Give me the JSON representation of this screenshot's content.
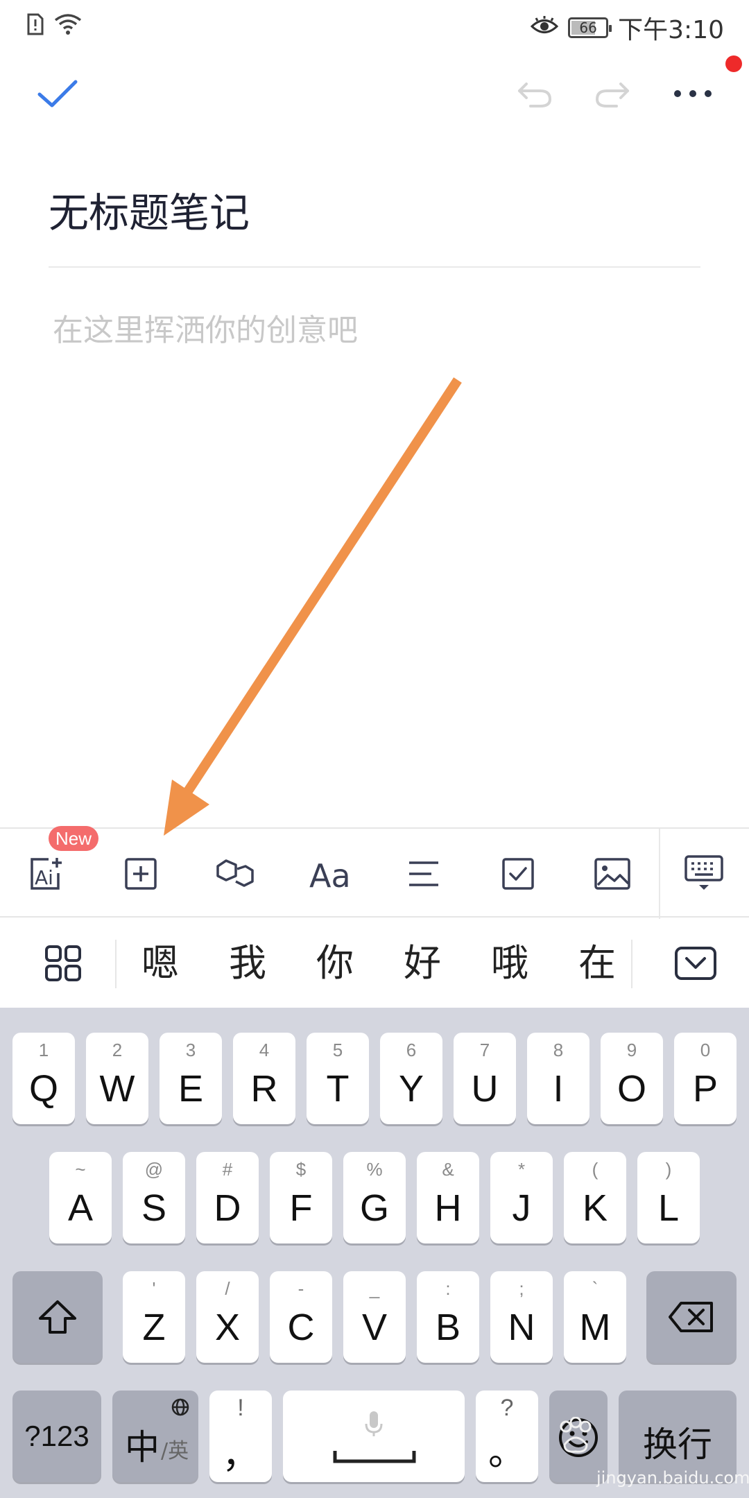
{
  "status_bar": {
    "time": "下午3:10",
    "battery_level": "66",
    "battery_fraction": 0.66
  },
  "note": {
    "title": "无标题笔记",
    "body_placeholder": "在这里挥洒你的创意吧"
  },
  "format_toolbar": {
    "new_badge": "New"
  },
  "candidates": [
    "嗯",
    "我",
    "你",
    "好",
    "哦",
    "在"
  ],
  "keyboard": {
    "row1": [
      {
        "hint": "1",
        "key": "Q"
      },
      {
        "hint": "2",
        "key": "W"
      },
      {
        "hint": "3",
        "key": "E"
      },
      {
        "hint": "4",
        "key": "R"
      },
      {
        "hint": "5",
        "key": "T"
      },
      {
        "hint": "6",
        "key": "Y"
      },
      {
        "hint": "7",
        "key": "U"
      },
      {
        "hint": "8",
        "key": "I"
      },
      {
        "hint": "9",
        "key": "O"
      },
      {
        "hint": "0",
        "key": "P"
      }
    ],
    "row2": [
      {
        "hint": "~",
        "key": "A"
      },
      {
        "hint": "@",
        "key": "S"
      },
      {
        "hint": "#",
        "key": "D"
      },
      {
        "hint": "$",
        "key": "F"
      },
      {
        "hint": "%",
        "key": "G"
      },
      {
        "hint": "&",
        "key": "H"
      },
      {
        "hint": "*",
        "key": "J"
      },
      {
        "hint": "(",
        "key": "K"
      },
      {
        "hint": ")",
        "key": "L"
      }
    ],
    "row3": [
      {
        "hint": "'",
        "key": "Z"
      },
      {
        "hint": "/",
        "key": "X"
      },
      {
        "hint": "-",
        "key": "C"
      },
      {
        "hint": "_",
        "key": "V"
      },
      {
        "hint": ":",
        "key": "B"
      },
      {
        "hint": ";",
        "key": "N"
      },
      {
        "hint": "`",
        "key": "M"
      }
    ],
    "num_key": "?123",
    "lang_key_main": "中",
    "lang_key_sub": "/英",
    "punct_hint": "!",
    "punct_key": "，",
    "period_hint": "?",
    "period_key": "。",
    "enter_key": "换行"
  },
  "watermark": {
    "brand": "Bai",
    "site": "jingyan.baidu.com"
  },
  "colors": {
    "accent": "#3b7be8",
    "arrow": "#f0924a",
    "badge": "#f46c6c",
    "notif": "#ee2a2a",
    "keyboard_bg": "#d4d6df"
  }
}
